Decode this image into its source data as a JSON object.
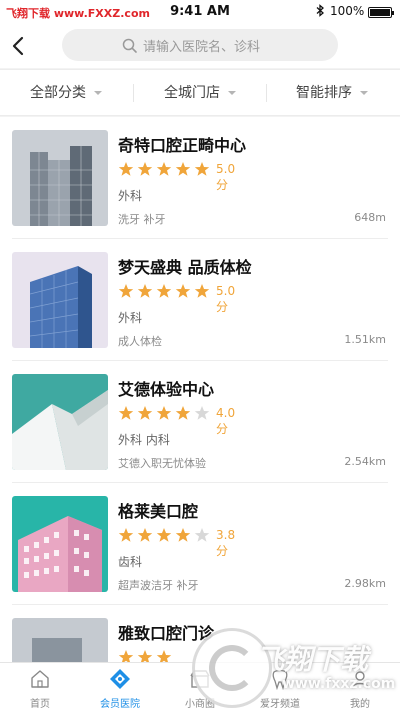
{
  "status_bar": {
    "watermark": "飞翔下载 www.FXXZ.com",
    "time": "9:41 AM",
    "battery": "100%",
    "icons": [
      "bluetooth-icon",
      "battery-icon"
    ]
  },
  "header": {
    "back_icon": "chevron-left-icon",
    "search_placeholder": "请输入医院名、诊科",
    "search_icon": "search-icon"
  },
  "filters": [
    {
      "label": "全部分类"
    },
    {
      "label": "全城门店"
    },
    {
      "label": "智能排序"
    }
  ],
  "colors": {
    "accent": "#1e8fe6",
    "star": "#f0a53a",
    "star_empty": "#d8d8d8",
    "score": "#f0a53a",
    "watermark_red": "#e0262b"
  },
  "clinics": [
    {
      "name": "奇特口腔正畸中心",
      "rating": 5,
      "score": "5.0分",
      "dept": "外科",
      "tags": "洗牙  补牙",
      "distance": "648m",
      "image": "glass-tower-photo"
    },
    {
      "name": "梦天盛典 品质体检",
      "rating": 5,
      "score": "5.0分",
      "dept": "外科",
      "tags": "成人体检",
      "distance": "1.51km",
      "image": "blue-office-tower-photo"
    },
    {
      "name": "艾德体验中心",
      "rating": 4,
      "score": "4.0分",
      "dept": "外科  内科",
      "tags": "艾德入职无忧体验",
      "distance": "2.54km",
      "image": "white-building-teal-sky-photo"
    },
    {
      "name": "格莱美口腔",
      "rating": 4,
      "score": "3.8分",
      "dept": "齿科",
      "tags": "超声波洁牙  补牙",
      "distance": "2.98km",
      "image": "pink-apartment-photo"
    },
    {
      "name": "雅致口腔门诊",
      "rating": 5,
      "score": "",
      "dept": "",
      "tags": "",
      "distance": "",
      "image": "grey-building-photo"
    }
  ],
  "tabs": [
    {
      "label": "首页",
      "icon": "home-icon",
      "active": false
    },
    {
      "label": "会员医院",
      "icon": "hospital-diamond-icon",
      "active": true
    },
    {
      "label": "小商圈",
      "icon": "shop-icon",
      "active": false
    },
    {
      "label": "爱牙频道",
      "icon": "tooth-icon",
      "active": false
    },
    {
      "label": "我的",
      "icon": "user-icon",
      "active": false
    }
  ],
  "overlay_logo": {
    "brand": "飞翔下载",
    "url": "www.fxxz.com"
  }
}
